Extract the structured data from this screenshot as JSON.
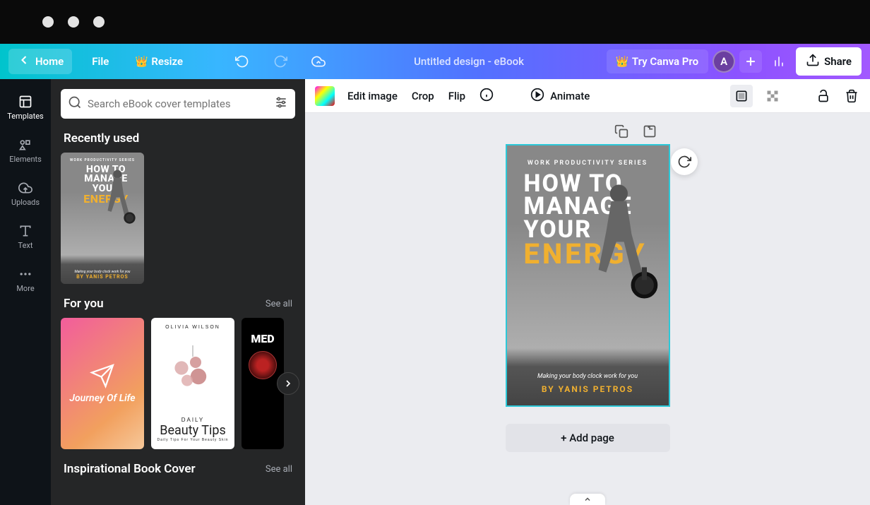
{
  "header": {
    "home": "Home",
    "file": "File",
    "resize": "Resize",
    "title": "Untitled design - eBook",
    "try_pro": "Try Canva Pro",
    "avatar_initial": "A",
    "share": "Share"
  },
  "rail": {
    "templates": "Templates",
    "elements": "Elements",
    "uploads": "Uploads",
    "text": "Text",
    "more": "More"
  },
  "panel": {
    "search_placeholder": "Search eBook cover templates",
    "recently_used": "Recently used",
    "for_you": "For you",
    "see_all": "See all",
    "inspirational": "Inspirational Book Cover"
  },
  "foryou": {
    "card1_title": "Journey Of Life",
    "card2_author": "OLIVIA WILSON",
    "card2_title": "Beauty Tips",
    "card2_prefix": "DAILY",
    "card2_sub": "Daily Tips For Your Beauty Skin",
    "card3_title": "MED"
  },
  "toolbar": {
    "edit_image": "Edit image",
    "crop": "Crop",
    "flip": "Flip",
    "animate": "Animate"
  },
  "cover": {
    "series": "WORK PRODUCTIVITY SERIES",
    "line1": "HOW TO",
    "line2": "MANAGE",
    "line3": "YOUR",
    "line4": "ENERGY",
    "subtitle": "Making your body clock work for you",
    "author": "BY YANIS PETROS"
  },
  "canvas": {
    "add_page": "+ Add page"
  }
}
